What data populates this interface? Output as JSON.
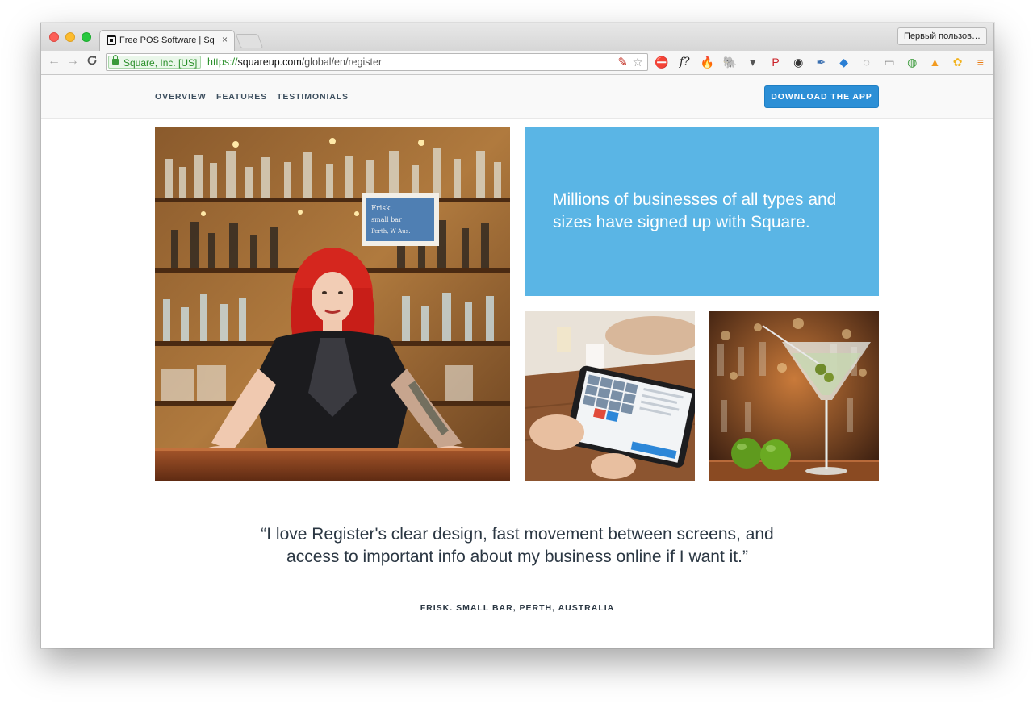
{
  "browser": {
    "tab_title": "Free POS Software | Square",
    "tab_close": "×",
    "profile_label": "Первый пользов…",
    "ev_label": "Square, Inc. [US]",
    "url_scheme": "https://",
    "url_host": "squareup.com",
    "url_path": "/global/en/register",
    "back_glyph": "←",
    "forward_glyph": "→",
    "reload_glyph": "C",
    "star_glyph": "☆",
    "square_ext_glyph": "✎",
    "extensions": [
      {
        "name": "adblock-icon",
        "glyph": "⛔",
        "color": "#d93025"
      },
      {
        "name": "font-finder-icon",
        "glyph": "f?",
        "color": "#222222"
      },
      {
        "name": "flame-icon",
        "glyph": "🔥",
        "color": "#e8611a"
      },
      {
        "name": "evernote-icon",
        "glyph": "🐘",
        "color": "#555555"
      },
      {
        "name": "pocket-icon",
        "glyph": "▾",
        "color": "#555555"
      },
      {
        "name": "pinterest-icon",
        "glyph": "P",
        "color": "#cb2027"
      },
      {
        "name": "color-wheel-icon",
        "glyph": "◉",
        "color": "#333333"
      },
      {
        "name": "eyedropper-icon",
        "glyph": "✒",
        "color": "#3a6fb0"
      },
      {
        "name": "diamond-icon",
        "glyph": "◆",
        "color": "#2a7fd4"
      },
      {
        "name": "refresh-circle-icon",
        "glyph": "◌",
        "color": "#777777"
      },
      {
        "name": "reader-icon",
        "glyph": "▭",
        "color": "#777777"
      },
      {
        "name": "badge-extension-icon",
        "glyph": "◍",
        "color": "#3a9a3a"
      },
      {
        "name": "analytics-icon",
        "glyph": "▲",
        "color": "#f29a1f"
      },
      {
        "name": "paw-icon",
        "glyph": "✿",
        "color": "#f2b31f"
      },
      {
        "name": "menu-icon",
        "glyph": "≡",
        "color": "#e8790f"
      }
    ]
  },
  "subnav": {
    "links": [
      "OVERVIEW",
      "FEATURES",
      "TESTIMONIALS"
    ],
    "cta": "DOWNLOAD THE APP"
  },
  "hero": {
    "panel_text": "Millions of businesses of all types and sizes have signed up with Square.",
    "chalkboard_text": "Frisk. small bar Perth, W Australia",
    "panel_color": "#5ab5e5"
  },
  "testimonial": {
    "quote": "“I love Register's clear design, fast movement between screens, and access to important info about my business online if I want it.”",
    "attribution": "FRISK. SMALL BAR, PERTH, AUSTRALIA"
  },
  "colors": {
    "accent": "#2c8fd6",
    "ev_green": "#2a8f2a"
  }
}
